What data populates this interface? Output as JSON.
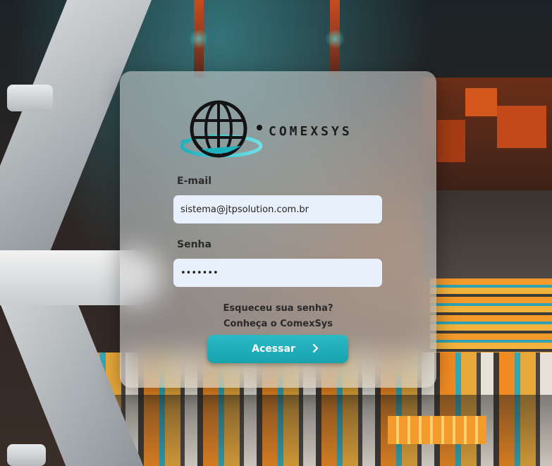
{
  "brand": {
    "name": "COMEXSYS",
    "icon": "globe-icon",
    "accent": "#1fb1bd"
  },
  "form": {
    "email_label": "E-mail",
    "email_value": "sistema@jtpsolution.com.br",
    "password_label": "Senha",
    "password_value": "•••••••"
  },
  "links": {
    "forgot": "Esqueceu sua senha?",
    "about": "Conheça o ComexSys"
  },
  "submit": {
    "label": "Acessar",
    "icon": "chevron-right-icon",
    "color": "#1fb1bd"
  }
}
